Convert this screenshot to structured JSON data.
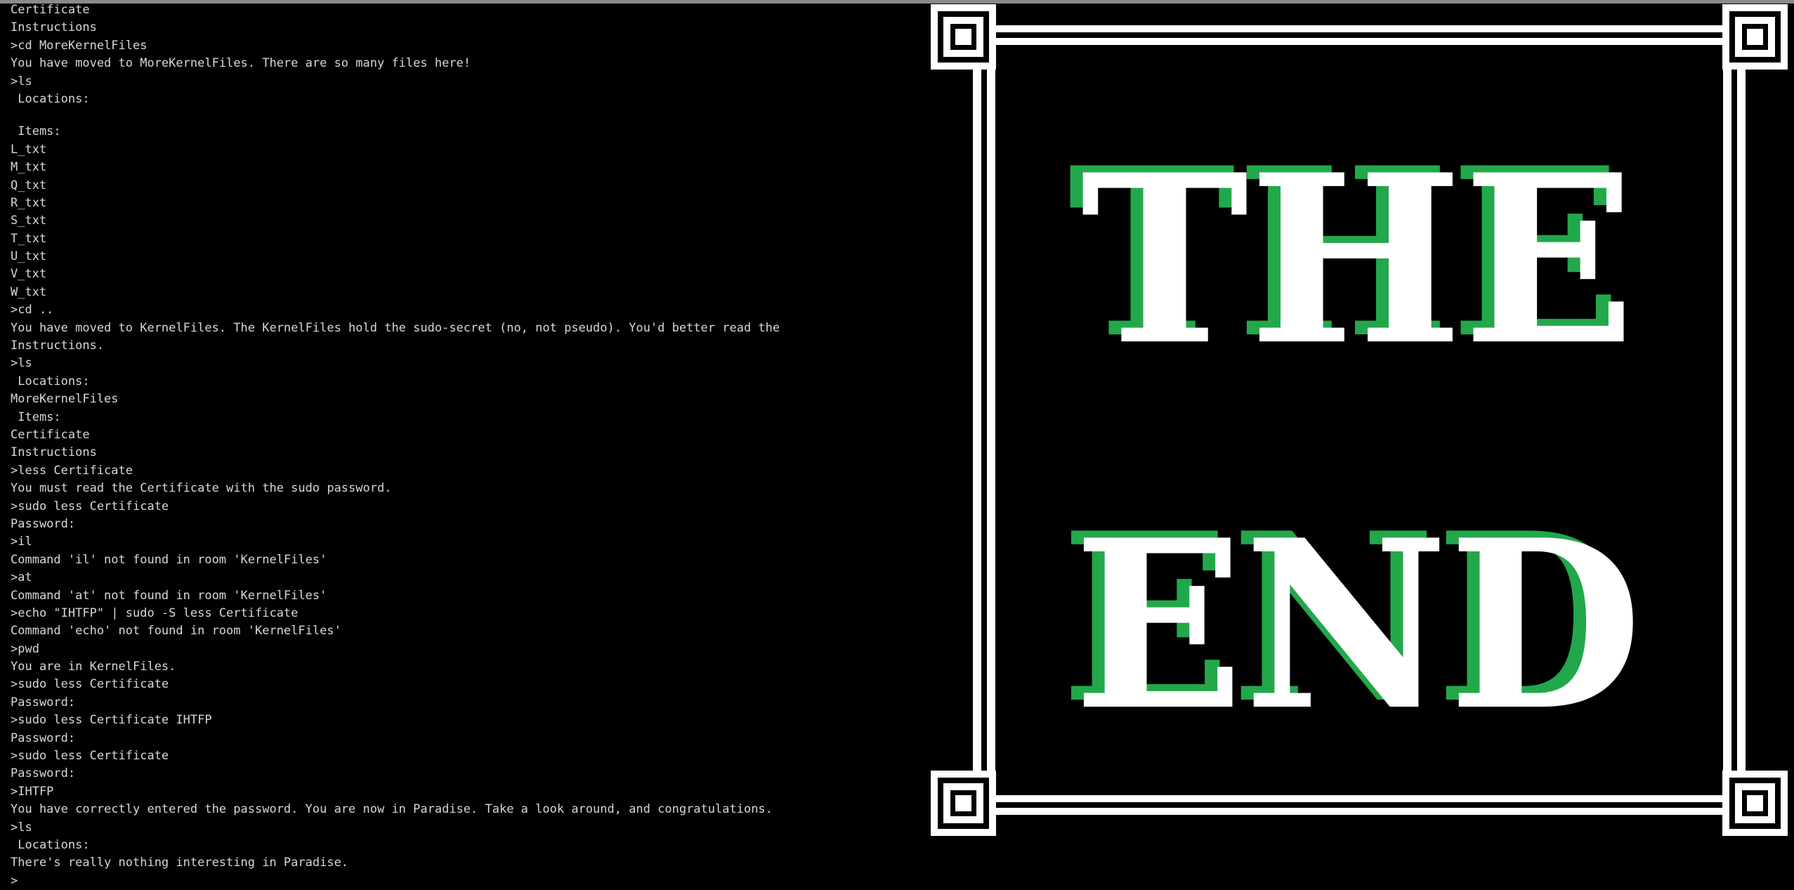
{
  "terminal": {
    "lines": [
      "Certificate",
      "Instructions",
      ">cd MoreKernelFiles",
      "You have moved to MoreKernelFiles. There are so many files here!",
      ">ls",
      " Locations:",
      "",
      " Items:",
      "L_txt",
      "M_txt",
      "Q_txt",
      "R_txt",
      "S_txt",
      "T_txt",
      "U_txt",
      "V_txt",
      "W_txt",
      ">cd ..",
      "You have moved to KernelFiles. The KernelFiles hold the sudo-secret (no, not pseudo). You'd better read the",
      "Instructions.",
      ">ls",
      " Locations:",
      "MoreKernelFiles",
      " Items:",
      "Certificate",
      "Instructions",
      ">less Certificate",
      "You must read the Certificate with the sudo password.",
      ">sudo less Certificate",
      "Password:",
      ">il",
      "Command 'il' not found in room 'KernelFiles'",
      ">at",
      "Command 'at' not found in room 'KernelFiles'",
      ">echo \"IHTFP\" | sudo -S less Certificate",
      "Command 'echo' not found in room 'KernelFiles'",
      ">pwd",
      "You are in KernelFiles.",
      ">sudo less Certificate",
      "Password:",
      ">sudo less Certificate IHTFP",
      "Password:",
      ">sudo less Certificate",
      "Password:",
      ">IHTFP",
      "You have correctly entered the password. You are now in Paradise. Take a look around, and congratulations.",
      ">ls",
      " Locations:",
      "There's really nothing interesting in Paradise.",
      ">"
    ]
  },
  "end_screen": {
    "word_top": "THE",
    "word_bottom": "END",
    "fill_color": "#ffffff",
    "shadow_color": "#22a84a",
    "frame_color": "#ffffff",
    "background_color": "#000000"
  }
}
